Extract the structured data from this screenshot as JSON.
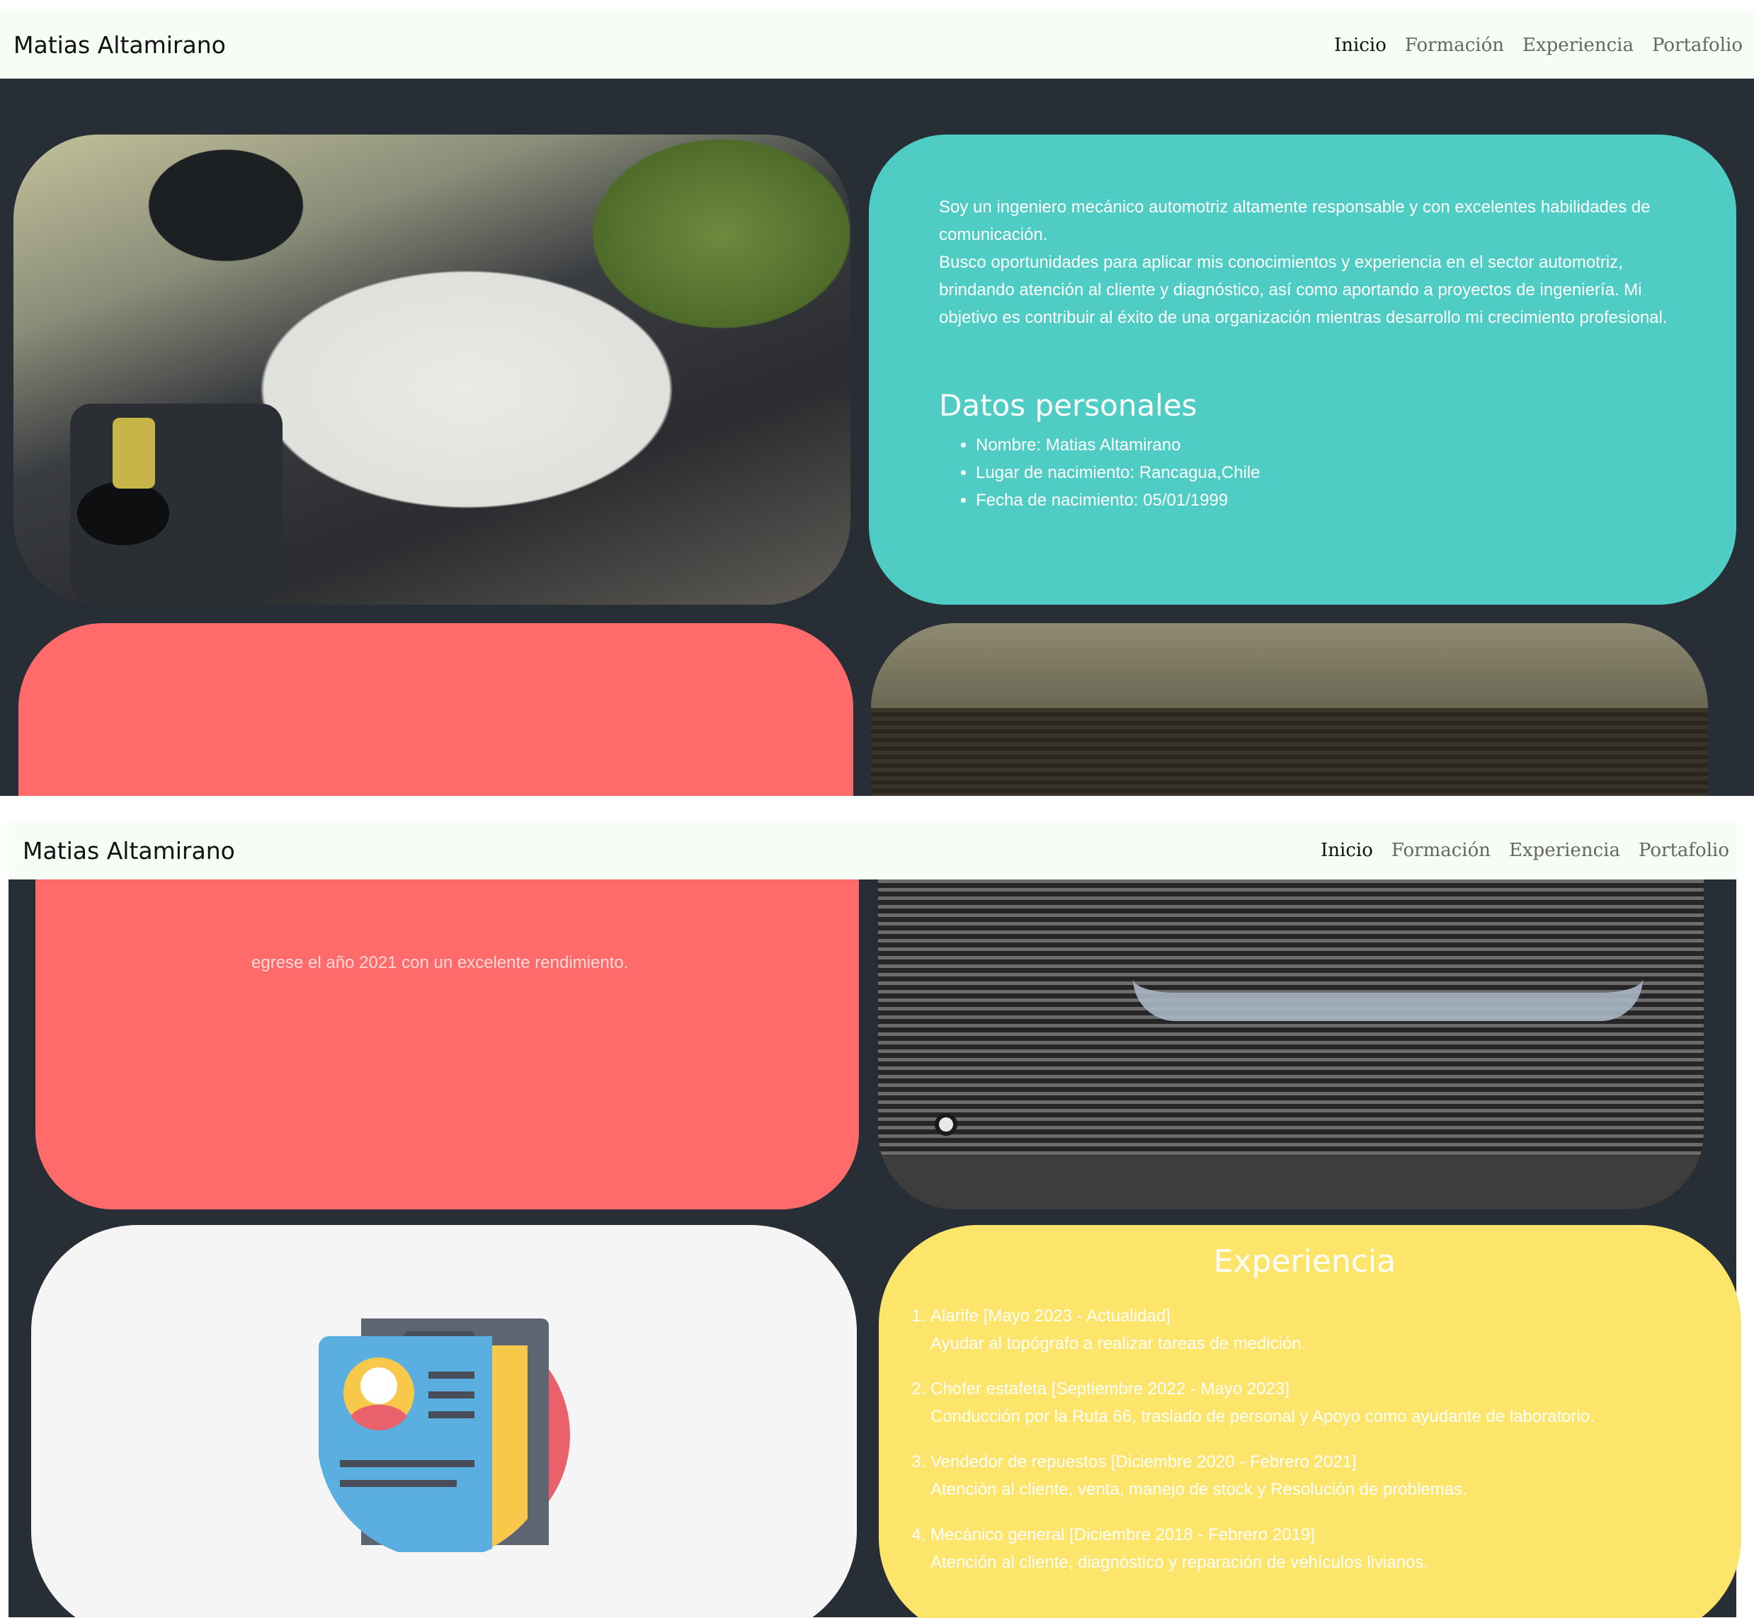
{
  "navbar": {
    "brand": "Matias Altamirano",
    "links": [
      "Inicio",
      "Formación",
      "Experiencia",
      "Portafolio"
    ]
  },
  "about": {
    "paragraph": "Soy un ingeniero mecánico automotriz altamente responsable y con excelentes habilidades de comunicación.",
    "paragraph2": "Busco oportunidades para aplicar mis conocimientos y experiencia en el sector automotriz, brindando atención al cliente y diagnóstico, así como aportando a proyectos de ingeniería. Mi objetivo es contribuir al éxito de una organización mientras desarrollo mi crecimiento profesional.",
    "personal_title": "Datos personales",
    "personal_items": [
      "Nombre: Matias Altamirano",
      "Lugar de nacimiento: Rancagua,Chile",
      "Fecha de nacimiento: 05/01/1999"
    ]
  },
  "formacion": {
    "partial_text": "egrese el año 2021 con un excelente rendimiento."
  },
  "experiencia": {
    "title": "Experiencia",
    "items": [
      {
        "role": "Alarife [Mayo 2023 - Actualidad]",
        "desc": "Ayudar al topógrafo a realizar tareas de medición."
      },
      {
        "role": "Chofer estafeta [Septiembre 2022 - Mayo 2023]",
        "desc": "Conducción por la Ruta 66, traslado de personal y Apoyo como ayudante de laboratorio."
      },
      {
        "role": "Vendedor de repuestos [Diciembre 2020 - Febrero 2021]",
        "desc": "Atención al cliente, venta, manejo de stock y Resolución de problemas."
      },
      {
        "role": "Mecánico general [Diciembre 2018 - Febrero 2019]",
        "desc": "Atención al cliente, diagnóstico y reparación de vehículos livianos."
      }
    ]
  },
  "colors": {
    "navbar_bg": "#f5fdf4",
    "page_bg": "#282e36",
    "about_card": "#4fcdc4",
    "formacion_card": "#ff6b6b",
    "experiencia_card": "#fde46a",
    "icon_card": "#f5f5f5"
  },
  "icons": [
    "resume-icon"
  ]
}
